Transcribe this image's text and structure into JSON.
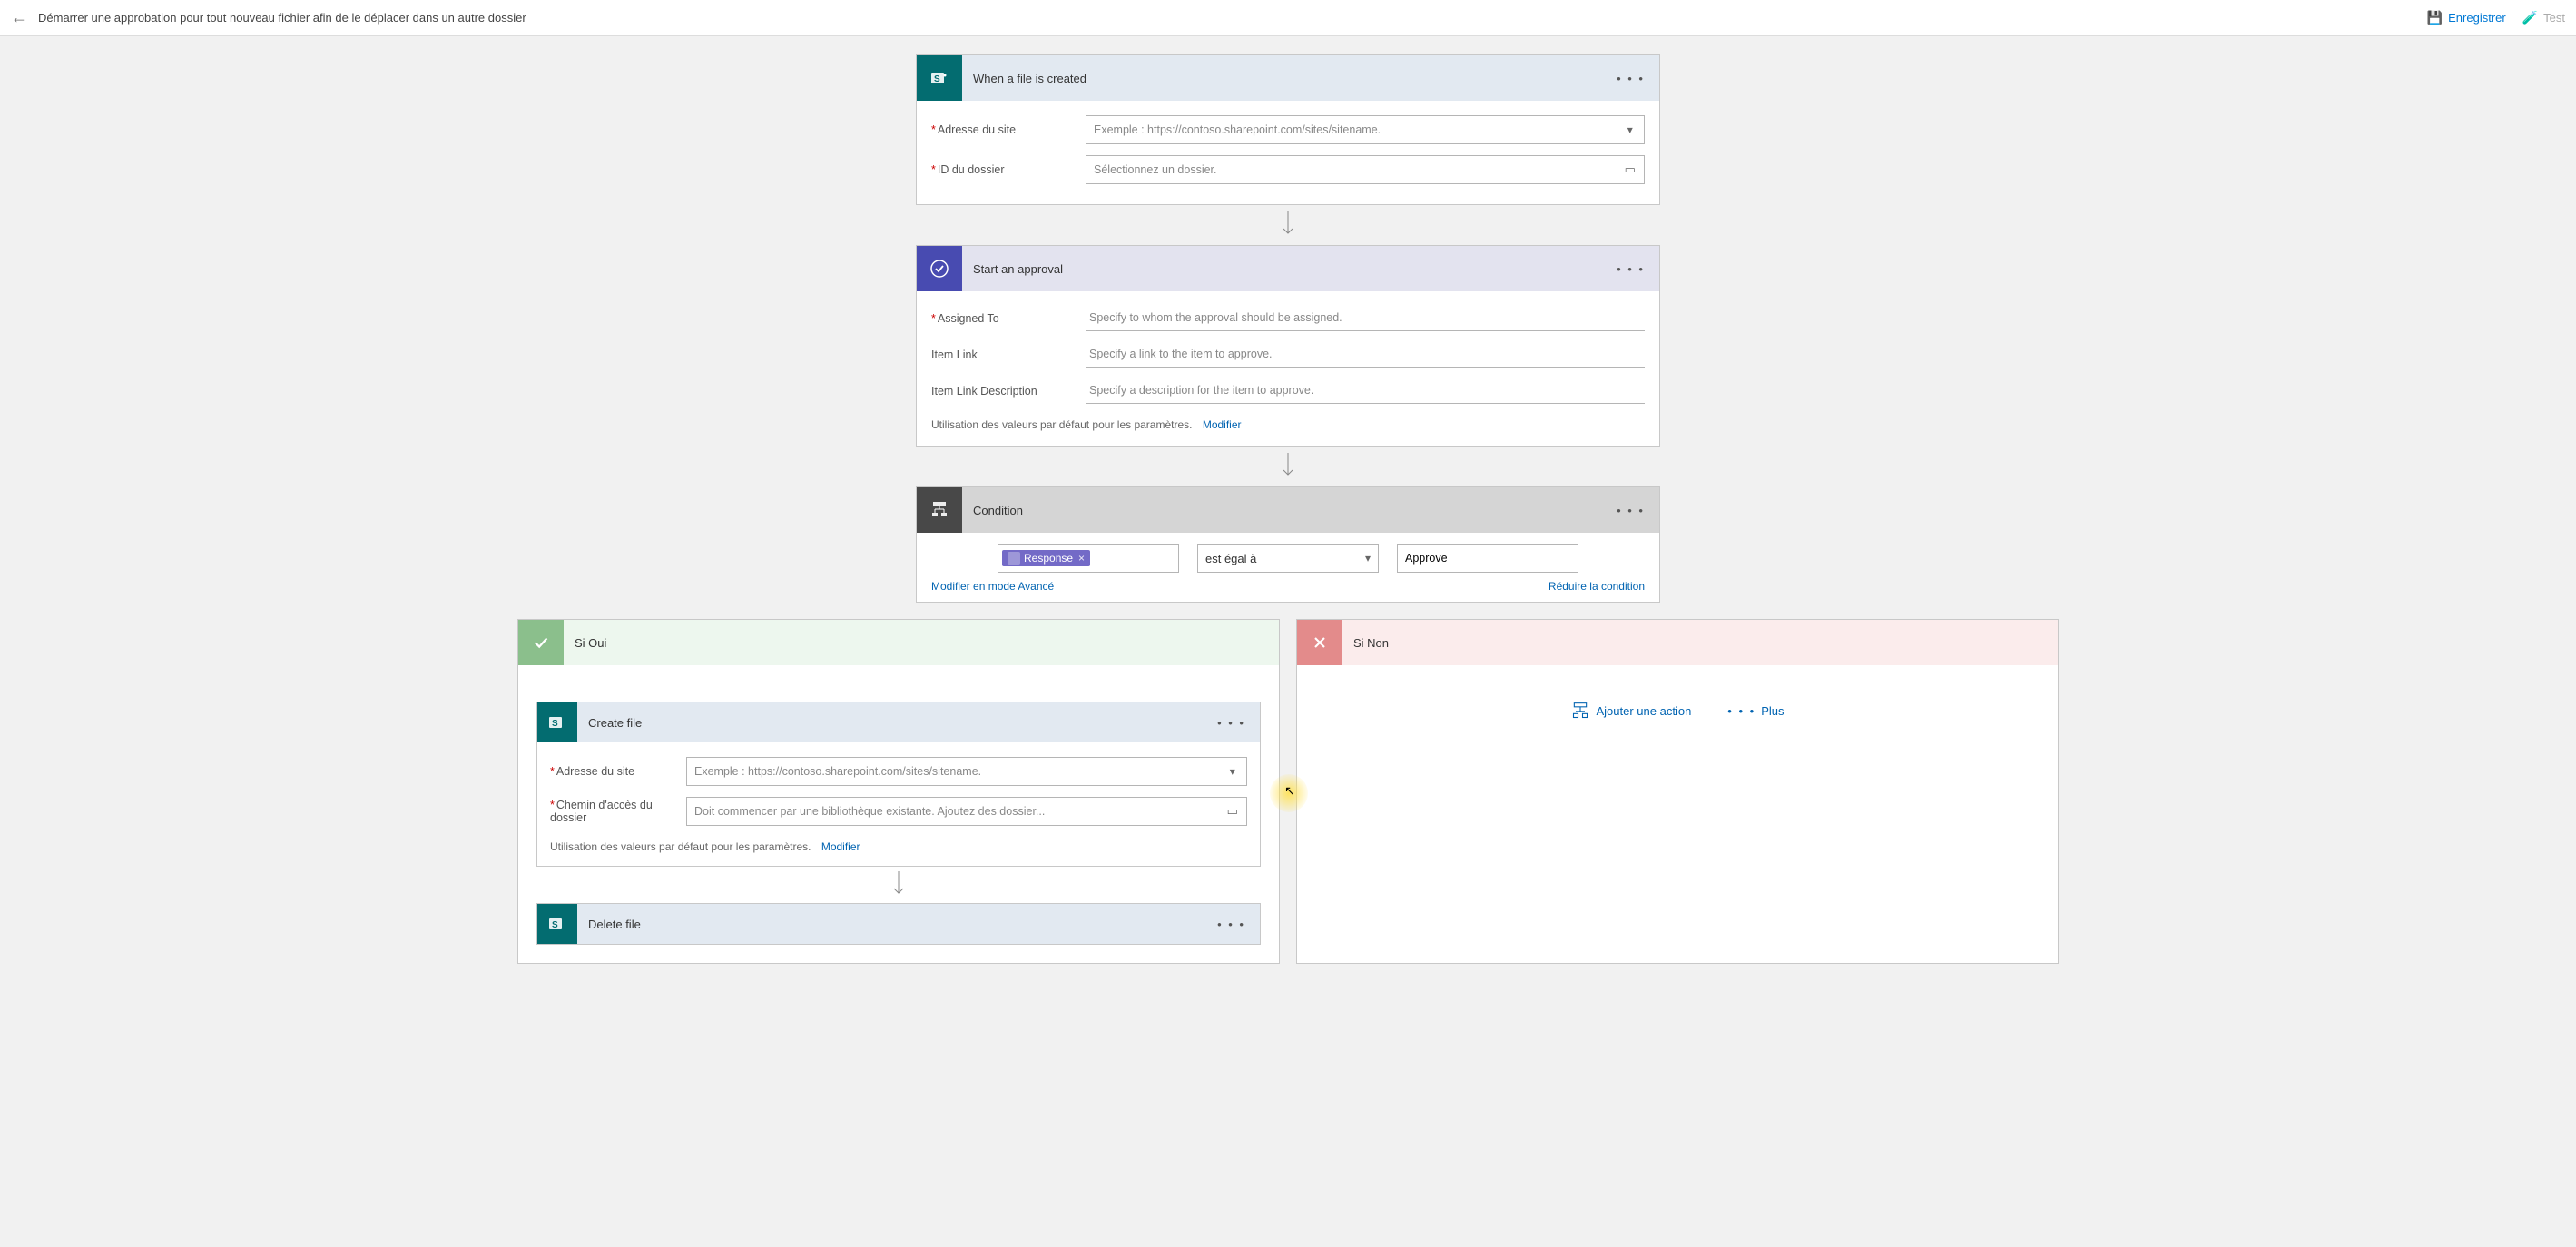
{
  "header": {
    "title": "Démarrer une approbation pour tout nouveau fichier afin de le déplacer dans un autre dossier",
    "save": "Enregistrer",
    "test": "Test"
  },
  "step1": {
    "title": "When a file is created",
    "site_label": "Adresse du site",
    "site_placeholder": "Exemple : https://contoso.sharepoint.com/sites/sitename.",
    "folder_label": "ID du dossier",
    "folder_placeholder": "Sélectionnez un dossier."
  },
  "step2": {
    "title": "Start an approval",
    "assigned_label": "Assigned To",
    "assigned_placeholder": "Specify to whom the approval should be assigned.",
    "link_label": "Item Link",
    "link_placeholder": "Specify a link to the item to approve.",
    "desc_label": "Item Link Description",
    "desc_placeholder": "Specify a description for the item to approve.",
    "defaults_text": "Utilisation des valeurs par défaut pour les paramètres.",
    "defaults_link": "Modifier"
  },
  "step3": {
    "title": "Condition",
    "token": "Response",
    "operator": "est égal à",
    "value": "Approve",
    "advanced_link": "Modifier en mode Avancé",
    "collapse_link": "Réduire la condition"
  },
  "branch_yes": {
    "title": "Si Oui",
    "create": {
      "title": "Create file",
      "site_label": "Adresse du site",
      "site_placeholder": "Exemple : https://contoso.sharepoint.com/sites/sitename.",
      "path_label": "Chemin d'accès du dossier",
      "path_placeholder": "Doit commencer par une bibliothèque existante. Ajoutez des dossier...",
      "defaults_text": "Utilisation des valeurs par défaut pour les paramètres.",
      "defaults_link": "Modifier"
    },
    "delete": {
      "title": "Delete file"
    }
  },
  "branch_no": {
    "title": "Si Non",
    "add_action": "Ajouter une action",
    "more": "Plus"
  }
}
